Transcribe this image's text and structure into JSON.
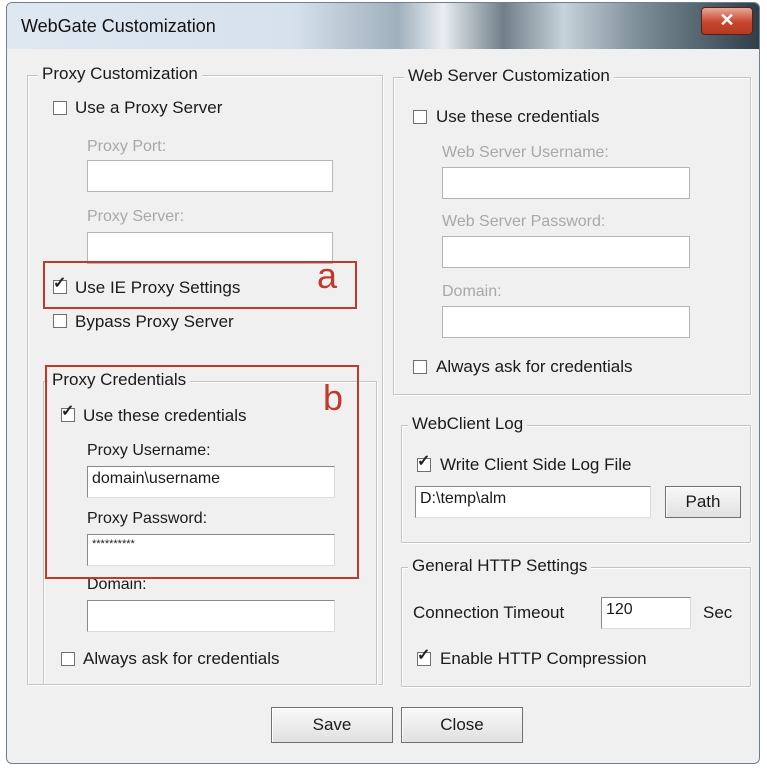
{
  "window": {
    "title": "WebGate Customization",
    "close_glyph": "✕"
  },
  "proxy": {
    "legend": "Proxy Customization",
    "use_proxy_label": "Use a Proxy Server",
    "use_proxy_checked": false,
    "port_label": "Proxy Port:",
    "port_value": "",
    "server_label": "Proxy Server:",
    "server_value": "",
    "use_ie_label": "Use IE Proxy Settings",
    "use_ie_checked": true,
    "bypass_label": "Bypass Proxy Server",
    "bypass_checked": false
  },
  "proxy_credentials": {
    "legend": "Proxy Credentials",
    "use_label": "Use these credentials",
    "use_checked": true,
    "username_label": "Proxy Username:",
    "username_value": "domain\\username",
    "password_label": "Proxy Password:",
    "password_value": "**********",
    "domain_label": "Domain:",
    "domain_value": "",
    "always_label": "Always ask for credentials",
    "always_checked": false
  },
  "webserver": {
    "legend": "Web Server Customization",
    "use_label": "Use these credentials",
    "use_checked": false,
    "username_label": "Web Server Username:",
    "username_value": "",
    "password_label": "Web Server Password:",
    "password_value": "",
    "domain_label": "Domain:",
    "domain_value": "",
    "always_label": "Always ask for credentials",
    "always_checked": false
  },
  "webclient": {
    "legend": "WebClient Log",
    "write_label": "Write Client Side Log File",
    "write_checked": true,
    "path_value": "D:\\temp\\alm",
    "path_button": "Path"
  },
  "http": {
    "legend": "General HTTP Settings",
    "timeout_label": "Connection Timeout",
    "timeout_value": "120",
    "timeout_unit": "Sec",
    "compression_label": "Enable HTTP Compression",
    "compression_checked": true
  },
  "footer": {
    "save": "Save",
    "close": "Close"
  },
  "annotations": {
    "a": "a",
    "b": "b",
    "color": "#c0392b"
  },
  "check_glyph": "✓"
}
